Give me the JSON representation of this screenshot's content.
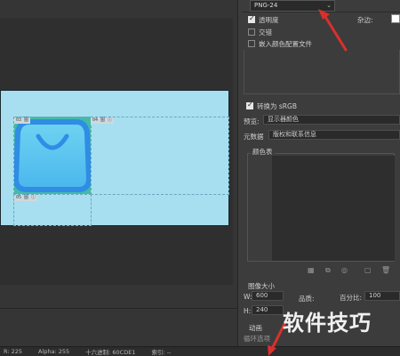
{
  "format_dropdown": {
    "value": "PNG-24"
  },
  "options": {
    "transparency": {
      "label": "透明度",
      "checked": true
    },
    "matte": {
      "label": "杂边:"
    },
    "interlaced": {
      "label": "交错",
      "checked": false
    },
    "embed_profile": {
      "label": "嵌入颜色配置文件",
      "checked": false
    }
  },
  "convert_srgb": {
    "label": "转换为 sRGB",
    "checked": true
  },
  "preview": {
    "label": "预览:",
    "value": "显示器颜色"
  },
  "metadata": {
    "label": "元数据",
    "value": "版权和联系信息"
  },
  "color_table": {
    "label": "颜色表"
  },
  "image_size": {
    "label": "图像大小",
    "w_label": "W:",
    "w_value": "600",
    "h_label": "H:",
    "h_value": "240",
    "percent_label": "百分比:",
    "percent_value": "100",
    "quality_label": "品质:"
  },
  "animation": {
    "label": "动画",
    "loop_label": "循环选项"
  },
  "slices": [
    {
      "tag": "03 图"
    },
    {
      "tag": "04 图 ⓘ"
    },
    {
      "tag": "05 图 ⓘ"
    }
  ],
  "status_bar": {
    "coord": "R: 225",
    "alpha": "Alpha: 255",
    "hex": "十六进制: 60CDE1",
    "index": "索引: --"
  },
  "watermark": "软件技巧",
  "colors": {
    "panel_bg": "#3c3c3c",
    "image_bg": "#a8dff0",
    "icon_blue": "#2f8de4",
    "slice_green": "#3db8a0",
    "annotation_red": "#d9302c"
  }
}
